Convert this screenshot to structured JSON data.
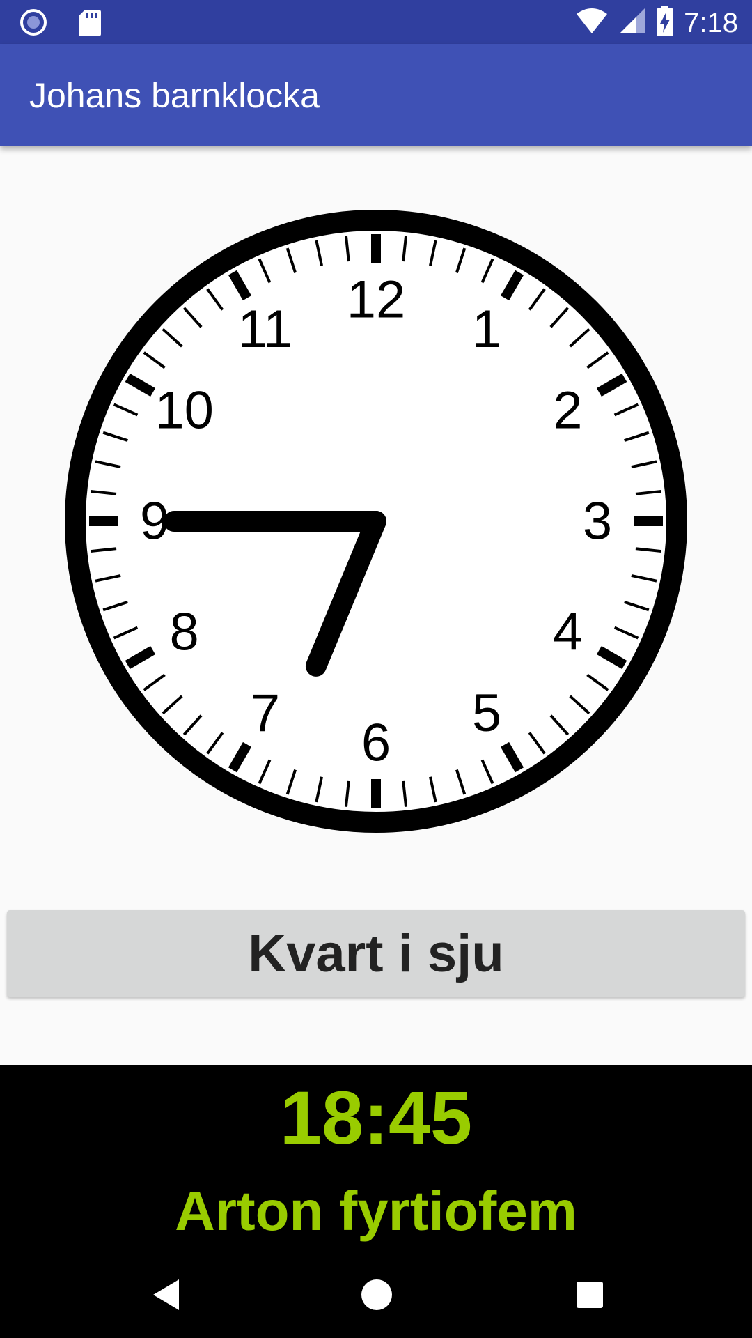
{
  "status_bar": {
    "time": "7:18",
    "icons": [
      "circle-icon",
      "sd-card-icon",
      "wifi-icon",
      "signal-icon",
      "battery-charging-icon"
    ]
  },
  "app_bar": {
    "title": "Johans barnklocka"
  },
  "clock": {
    "hour": 18,
    "minute": 45,
    "numbers": [
      "12",
      "1",
      "2",
      "3",
      "4",
      "5",
      "6",
      "7",
      "8",
      "9",
      "10",
      "11"
    ]
  },
  "time_button": {
    "label": "Kvart i sju"
  },
  "digital": {
    "time": "18:45",
    "spoken": "Arton fyrtiofem"
  },
  "nav_bar": {
    "buttons": [
      "back-icon",
      "home-icon",
      "recents-icon"
    ]
  },
  "colors": {
    "status_bar": "#303f9f",
    "app_bar": "#3f51b5",
    "accent_text": "#99cc00",
    "button_bg": "#d6d7d7"
  }
}
